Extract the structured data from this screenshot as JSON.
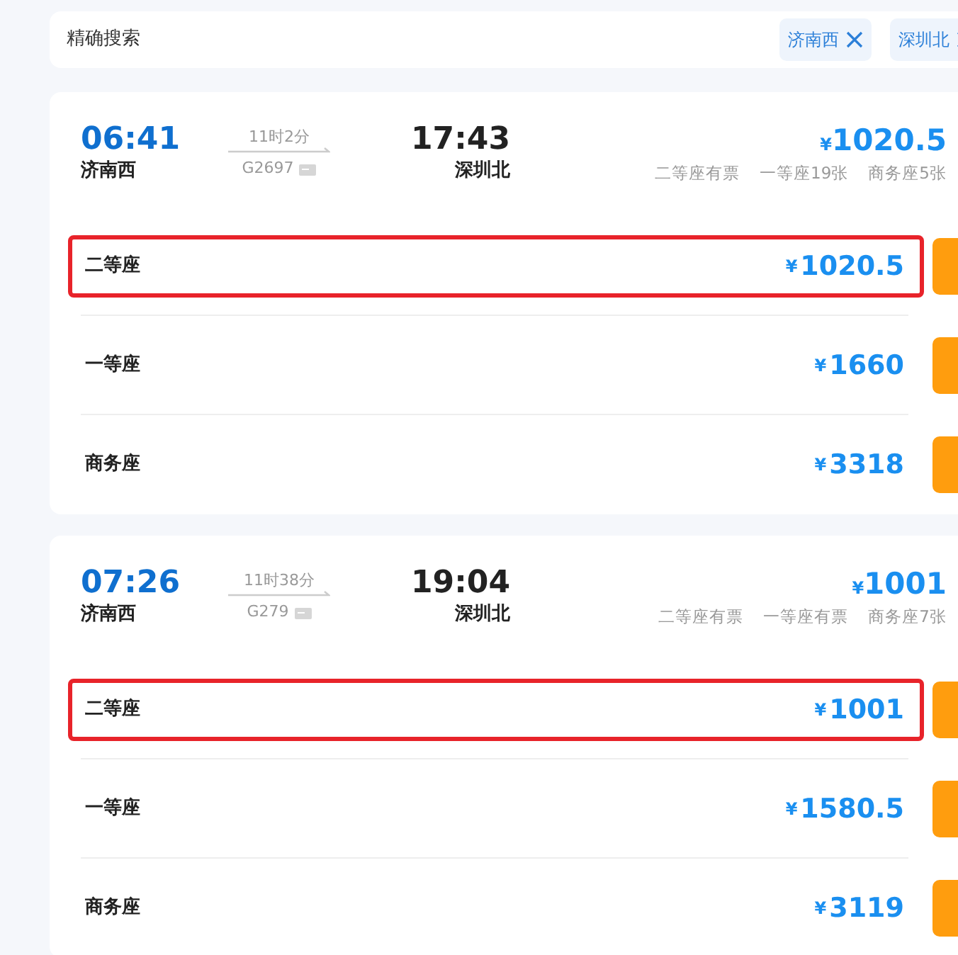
{
  "search": {
    "label": "精确搜索",
    "chips": [
      {
        "text": "济南西"
      },
      {
        "text": "深圳北"
      }
    ]
  },
  "trains": [
    {
      "depart_time": "06:41",
      "depart_station": "济南西",
      "duration": "11时2分",
      "train_no": "G2697",
      "arrive_time": "17:43",
      "arrive_station": "深圳北",
      "price_symbol": "¥",
      "price": "1020.5",
      "availability": [
        "二等座有票",
        "一等座19张",
        "商务座5张"
      ],
      "seats": [
        {
          "name": "二等座",
          "price_symbol": "¥",
          "price": "1020.5",
          "selected": true
        },
        {
          "name": "一等座",
          "price_symbol": "¥",
          "price": "1660",
          "selected": false
        },
        {
          "name": "商务座",
          "price_symbol": "¥",
          "price": "3318",
          "selected": false
        }
      ]
    },
    {
      "depart_time": "07:26",
      "depart_station": "济南西",
      "duration": "11时38分",
      "train_no": "G279",
      "arrive_time": "19:04",
      "arrive_station": "深圳北",
      "price_symbol": "¥",
      "price": "1001",
      "availability": [
        "二等座有票",
        "一等座有票",
        "商务座7张"
      ],
      "seats": [
        {
          "name": "二等座",
          "price_symbol": "¥",
          "price": "1001",
          "selected": true
        },
        {
          "name": "一等座",
          "price_symbol": "¥",
          "price": "1580.5",
          "selected": false
        },
        {
          "name": "商务座",
          "price_symbol": "¥",
          "price": "3119",
          "selected": false
        }
      ]
    }
  ]
}
